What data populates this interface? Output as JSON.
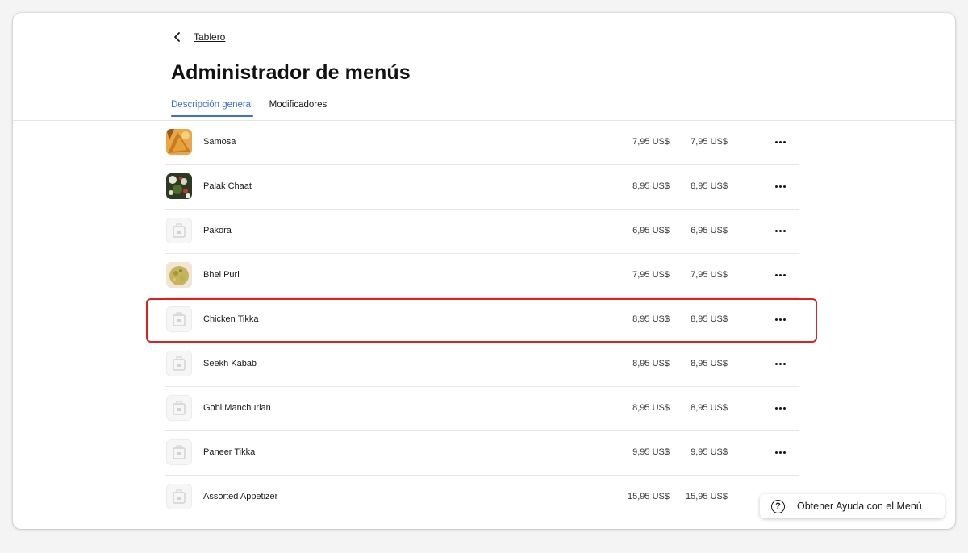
{
  "breadcrumb": {
    "label": "Tablero"
  },
  "page": {
    "title": "Administrador de menús"
  },
  "tabs": [
    {
      "label": "Descripción general",
      "active": true
    },
    {
      "label": "Modificadores",
      "active": false
    }
  ],
  "items": [
    {
      "name": "Samosa",
      "price": "7,95 US$",
      "price2": "7,95 US$",
      "image": "photo-samosa"
    },
    {
      "name": "Palak Chaat",
      "price": "8,95 US$",
      "price2": "8,95 US$",
      "image": "photo-palak-chaat"
    },
    {
      "name": "Pakora",
      "price": "6,95 US$",
      "price2": "6,95 US$",
      "image": "placeholder-icon"
    },
    {
      "name": "Bhel Puri",
      "price": "7,95 US$",
      "price2": "7,95 US$",
      "image": "photo-bhel-puri"
    },
    {
      "name": "Chicken Tikka",
      "price": "8,95 US$",
      "price2": "8,95 US$",
      "image": "placeholder-icon"
    },
    {
      "name": "Seekh Kabab",
      "price": "8,95 US$",
      "price2": "8,95 US$",
      "image": "placeholder-icon"
    },
    {
      "name": "Gobi Manchurian",
      "price": "8,95 US$",
      "price2": "8,95 US$",
      "image": "placeholder-icon"
    },
    {
      "name": "Paneer Tikka",
      "price": "9,95 US$",
      "price2": "9,95 US$",
      "image": "placeholder-icon"
    },
    {
      "name": "Assorted Appetizer",
      "price": "15,95 US$",
      "price2": "15,95 US$",
      "image": "placeholder-icon"
    }
  ],
  "help": {
    "label": "Obtener Ayuda con el Menú",
    "icon": "question-circle-icon"
  },
  "colors": {
    "accent": "#3b6fd8",
    "highlight": "#e02020"
  }
}
